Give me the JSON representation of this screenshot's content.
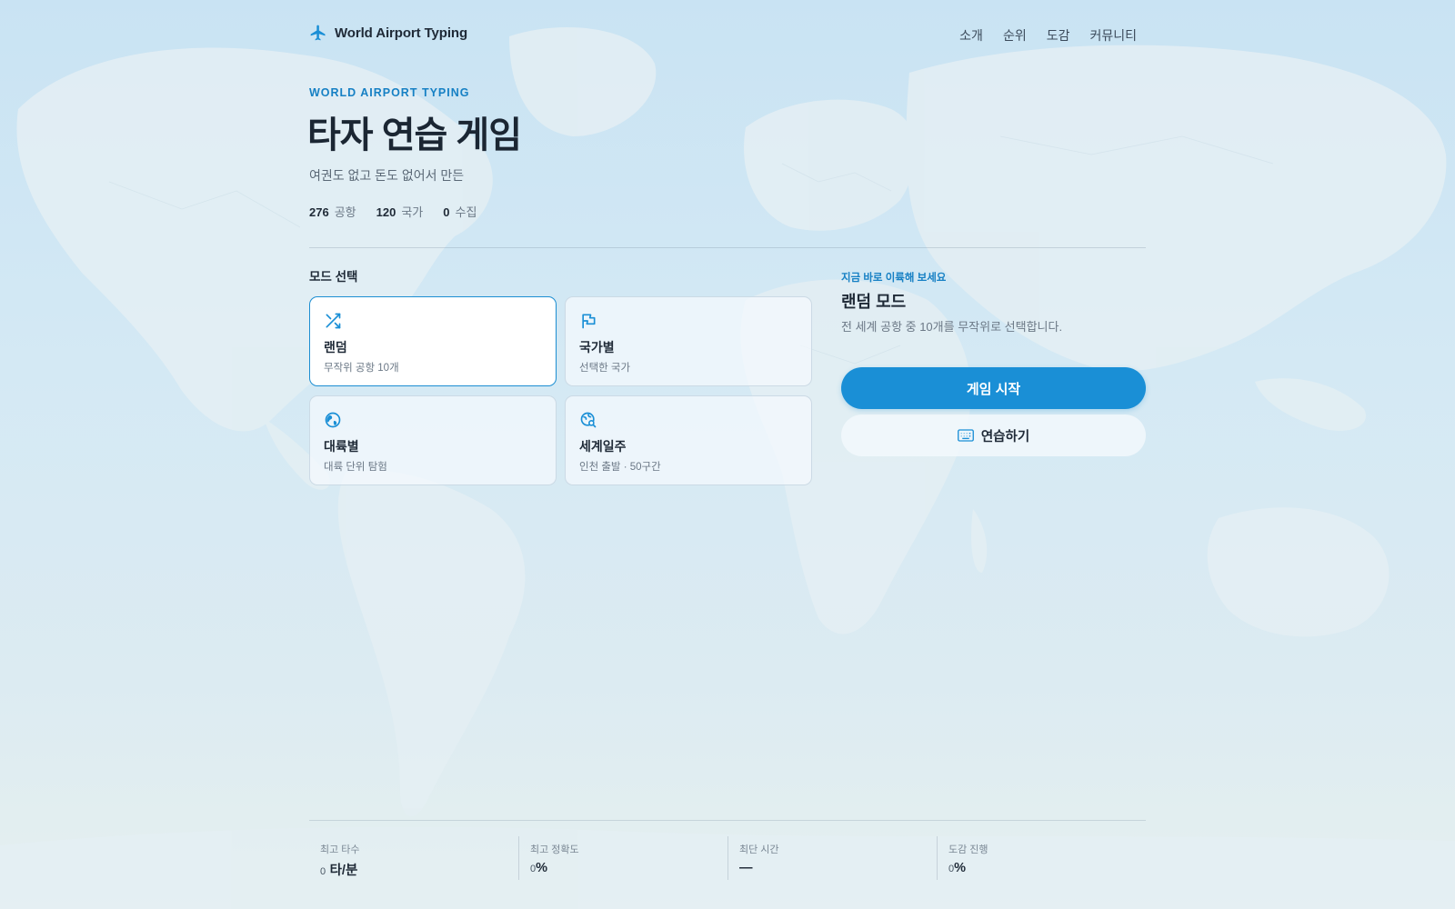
{
  "header": {
    "brand": "World Airport Typing",
    "nav": [
      "소개",
      "순위",
      "도감",
      "커뮤니티"
    ]
  },
  "hero": {
    "eyebrow": "WORLD AIRPORT TYPING",
    "title": "타자 연습 게임",
    "subtitle": "여권도 없고 돈도 없어서 만든",
    "stats": [
      {
        "value": "276",
        "label": "공항"
      },
      {
        "value": "120",
        "label": "국가"
      },
      {
        "value": "0",
        "label": "수집"
      }
    ]
  },
  "modes": {
    "heading": "모드 선택",
    "items": [
      {
        "name": "랜덤",
        "desc": "무작위 공항 10개",
        "icon": "shuffle-icon",
        "selected": true
      },
      {
        "name": "국가별",
        "desc": "선택한 국가",
        "icon": "flag-icon",
        "selected": false
      },
      {
        "name": "대륙별",
        "desc": "대륙 단위 탐험",
        "icon": "globe-icon",
        "selected": false
      },
      {
        "name": "세계일주",
        "desc": "인천 출발 · 50구간",
        "icon": "globe-search-icon",
        "selected": false
      }
    ]
  },
  "cta": {
    "eyebrow": "지금 바로 이륙해 보세요",
    "title": "랜덤 모드",
    "desc": "전 세계 공항 중 10개를 무작위로 선택합니다.",
    "start_label": "게임 시작",
    "practice_label": "연습하기",
    "practice_icon": "keyboard-icon"
  },
  "bottom_stats": [
    {
      "label": "최고 타수",
      "num": "0",
      "unit": "타/분"
    },
    {
      "label": "최고 정확도",
      "num": "0",
      "unit": "%"
    },
    {
      "label": "최단 시간",
      "num": "",
      "unit": "—"
    },
    {
      "label": "도감 진행",
      "num": "0",
      "unit": "%"
    }
  ],
  "colors": {
    "accent": "#1a8fd6",
    "text": "#1f2a37",
    "muted": "#6b7886"
  }
}
